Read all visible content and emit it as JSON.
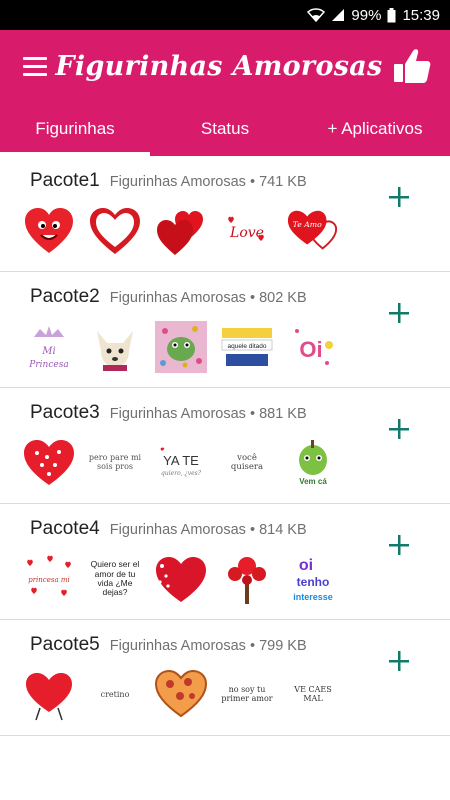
{
  "status_bar": {
    "battery": "99%",
    "time": "15:39"
  },
  "app_bar": {
    "title": "Figurinhas Amorosas"
  },
  "tabs": [
    {
      "label": "Figurinhas",
      "active": true
    },
    {
      "label": "Status",
      "active": false
    },
    {
      "label": "+ Aplicativos",
      "active": false
    }
  ],
  "packs": [
    {
      "name": "Pacote1",
      "meta": "Figurinhas Amorosas • 741 KB",
      "stickers": [
        "heart-face-icon",
        "outline-heart-icon",
        "double-heart-icon",
        "love-text-icon",
        "te-amo-heart-icon"
      ],
      "sticker_texts": [
        "",
        "",
        "",
        "Love",
        "Te Amo"
      ]
    },
    {
      "name": "Pacote2",
      "meta": "Figurinhas Amorosas • 802 KB",
      "stickers": [
        "mi-princesa-icon",
        "dog-photo-icon",
        "frog-hearts-icon",
        "quote-sticker-icon",
        "oi-sticker-icon"
      ],
      "sticker_texts": [
        "Mi Princesa",
        "",
        "",
        "aquele ditado",
        "Oi"
      ]
    },
    {
      "name": "Pacote3",
      "meta": "Figurinhas Amorosas • 881 KB",
      "stickers": [
        "dotted-heart-icon",
        "nobody-text-icon",
        "ya-te-icon",
        "voce-quisera-icon",
        "apple-character-icon"
      ],
      "sticker_texts": [
        "",
        "pero pare mi sois pros",
        "YA TE",
        "você quisera",
        "Vem cá"
      ]
    },
    {
      "name": "Pacote4",
      "meta": "Figurinhas Amorosas • 814 KB",
      "stickers": [
        "small-hearts-icon",
        "quiero-ser-icon",
        "half-heart-icon",
        "heart-tree-icon",
        "oi-tenho-icon"
      ],
      "sticker_texts": [
        "",
        "Quiero ser el amor de tu vida ¿Me dejas?",
        "",
        "",
        "oi tenho interesse"
      ]
    },
    {
      "name": "Pacote5",
      "meta": "Figurinhas Amorosas • 799 KB",
      "stickers": [
        "heart-character-icon",
        "cretino-text-icon",
        "pizza-heart-icon",
        "no-soy-text-icon",
        "ve-caes-text-icon"
      ],
      "sticker_texts": [
        "",
        "cretino",
        "",
        "no soy tu primer amor",
        "VE CAES MAL"
      ]
    }
  ],
  "colors": {
    "primary": "#d81b6b",
    "accent": "#127a6a"
  }
}
